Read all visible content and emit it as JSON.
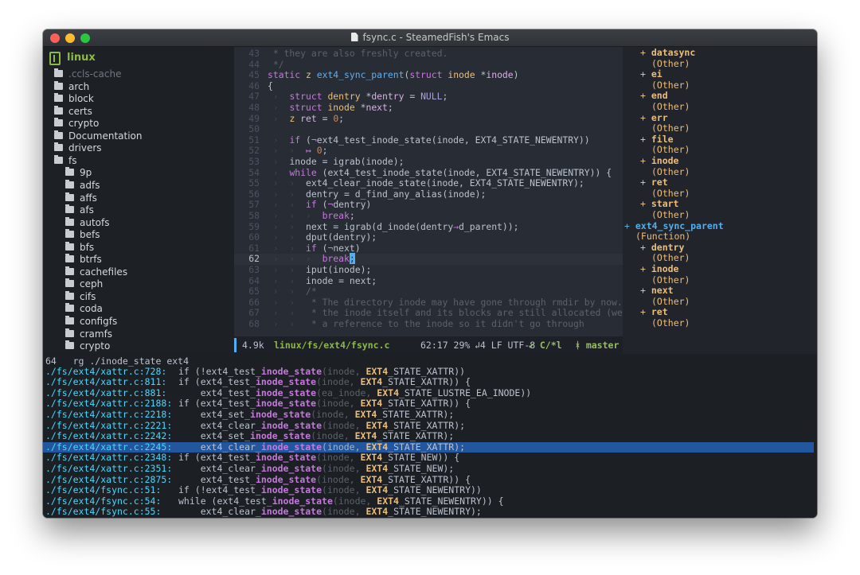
{
  "window": {
    "title": "fsync.c - SteamedFish's Emacs"
  },
  "sidebar": {
    "project": "linux",
    "items": [
      {
        "label": ".ccls-cache",
        "depth": 0,
        "dim": true
      },
      {
        "label": "arch",
        "depth": 0
      },
      {
        "label": "block",
        "depth": 0
      },
      {
        "label": "certs",
        "depth": 0
      },
      {
        "label": "crypto",
        "depth": 0
      },
      {
        "label": "Documentation",
        "depth": 0
      },
      {
        "label": "drivers",
        "depth": 0
      },
      {
        "label": "fs",
        "depth": 0
      },
      {
        "label": "9p",
        "depth": 1
      },
      {
        "label": "adfs",
        "depth": 1
      },
      {
        "label": "affs",
        "depth": 1
      },
      {
        "label": "afs",
        "depth": 1
      },
      {
        "label": "autofs",
        "depth": 1
      },
      {
        "label": "befs",
        "depth": 1
      },
      {
        "label": "bfs",
        "depth": 1
      },
      {
        "label": "btrfs",
        "depth": 1
      },
      {
        "label": "cachefiles",
        "depth": 1
      },
      {
        "label": "ceph",
        "depth": 1
      },
      {
        "label": "cifs",
        "depth": 1
      },
      {
        "label": "coda",
        "depth": 1
      },
      {
        "label": "configfs",
        "depth": 1
      },
      {
        "label": "cramfs",
        "depth": 1
      },
      {
        "label": "crypto",
        "depth": 1
      }
    ]
  },
  "editor": {
    "current_line": "62",
    "lines": [
      {
        "n": "43",
        "parts": [
          [
            "cmt",
            " * they are also freshly created."
          ]
        ]
      },
      {
        "n": "44",
        "parts": [
          [
            "cmt",
            " */"
          ]
        ]
      },
      {
        "n": "45",
        "parts": [
          [
            "kw",
            "static "
          ],
          [
            "ty",
            "z "
          ],
          [
            "fn",
            "ext4_sync_parent"
          ],
          [
            "",
            "("
          ],
          [
            "kw",
            "struct "
          ],
          [
            "ty",
            "inode "
          ],
          [
            "",
            "*"
          ],
          [
            "var",
            "inode"
          ],
          [
            "",
            ")"
          ]
        ]
      },
      {
        "n": "46",
        "parts": [
          [
            "",
            "{"
          ]
        ]
      },
      {
        "n": "47",
        "parts": [
          [
            "ind",
            " ›  "
          ],
          [
            "kw",
            "struct "
          ],
          [
            "ty",
            "dentry "
          ],
          [
            "",
            "*"
          ],
          [
            "var",
            "dentry"
          ],
          [
            "",
            " = "
          ],
          [
            "cst",
            "NULL"
          ],
          [
            "",
            ";"
          ]
        ]
      },
      {
        "n": "48",
        "parts": [
          [
            "ind",
            " ›  "
          ],
          [
            "kw",
            "struct "
          ],
          [
            "ty",
            "inode "
          ],
          [
            "",
            "*"
          ],
          [
            "var",
            "next"
          ],
          [
            "",
            ";"
          ]
        ]
      },
      {
        "n": "49",
        "parts": [
          [
            "ind",
            " ›  "
          ],
          [
            "ty",
            "z "
          ],
          [
            "var",
            "ret"
          ],
          [
            "",
            " = "
          ],
          [
            "num",
            "0"
          ],
          [
            "",
            ";"
          ]
        ]
      },
      {
        "n": "50",
        "parts": [
          [
            "",
            ""
          ]
        ]
      },
      {
        "n": "51",
        "parts": [
          [
            "ind",
            " ›  "
          ],
          [
            "kw",
            "if "
          ],
          [
            "",
            "("
          ],
          [
            "op",
            "¬"
          ],
          [
            "",
            "ext4_test_inode_state(inode, EXT4_STATE_NEWENTRY))"
          ]
        ]
      },
      {
        "n": "52",
        "parts": [
          [
            "ind",
            " ›  ›  "
          ],
          [
            "op",
            "↦ "
          ],
          [
            "num",
            "0"
          ],
          [
            "",
            ";"
          ]
        ]
      },
      {
        "n": "53",
        "parts": [
          [
            "ind",
            " ›  "
          ],
          [
            "",
            "inode = igrab(inode);"
          ]
        ]
      },
      {
        "n": "54",
        "parts": [
          [
            "ind",
            " ›  "
          ],
          [
            "kw",
            "while "
          ],
          [
            "",
            "(ext4_test_inode_state(inode, EXT4_STATE_NEWENTRY)) {"
          ]
        ]
      },
      {
        "n": "55",
        "parts": [
          [
            "ind",
            " ›  ›  "
          ],
          [
            "",
            "ext4_clear_inode_state(inode, EXT4_STATE_NEWENTRY);"
          ]
        ]
      },
      {
        "n": "56",
        "parts": [
          [
            "ind",
            " ›  ›  "
          ],
          [
            "",
            "dentry = d_find_any_alias(inode);"
          ]
        ]
      },
      {
        "n": "57",
        "parts": [
          [
            "ind",
            " ›  ›  "
          ],
          [
            "kw",
            "if "
          ],
          [
            "",
            "("
          ],
          [
            "op",
            "¬"
          ],
          [
            "",
            "dentry)"
          ]
        ]
      },
      {
        "n": "58",
        "parts": [
          [
            "ind",
            " ›  ›  ›  "
          ],
          [
            "kw",
            "break"
          ],
          [
            "",
            ";"
          ]
        ]
      },
      {
        "n": "59",
        "parts": [
          [
            "ind",
            " ›  ›  "
          ],
          [
            "",
            "next = igrab(d_inode(dentry"
          ],
          [
            "op",
            "→"
          ],
          [
            "",
            "d_parent));"
          ]
        ]
      },
      {
        "n": "60",
        "parts": [
          [
            "ind",
            " ›  ›  "
          ],
          [
            "",
            "dput(dentry);"
          ]
        ]
      },
      {
        "n": "61",
        "parts": [
          [
            "ind",
            " ›  ›  "
          ],
          [
            "kw",
            "if "
          ],
          [
            "",
            "("
          ],
          [
            "op",
            "¬"
          ],
          [
            "",
            "next)"
          ]
        ]
      },
      {
        "n": "62",
        "parts": [
          [
            "ind",
            " ›  ›  ›  "
          ],
          [
            "kw",
            "break"
          ],
          [
            "cursor",
            ";"
          ]
        ]
      },
      {
        "n": "63",
        "parts": [
          [
            "ind",
            " ›  ›  "
          ],
          [
            "",
            "iput(inode);"
          ]
        ]
      },
      {
        "n": "64",
        "parts": [
          [
            "ind",
            " ›  ›  "
          ],
          [
            "",
            "inode = next;"
          ]
        ]
      },
      {
        "n": "65",
        "parts": [
          [
            "ind",
            " ›  ›  "
          ],
          [
            "cmt",
            "/*"
          ]
        ]
      },
      {
        "n": "66",
        "parts": [
          [
            "ind",
            " ›  ›  "
          ],
          [
            "cmt",
            " * The directory inode may have gone through rmdir by now."
          ]
        ]
      },
      {
        "n": "67",
        "parts": [
          [
            "ind",
            " ›  ›  "
          ],
          [
            "cmt",
            " * the inode itself and its blocks are still allocated (we"
          ]
        ]
      },
      {
        "n": "68",
        "parts": [
          [
            "ind",
            " ›  ›  "
          ],
          [
            "cmt",
            " * a reference to the inode so it didn't go through"
          ]
        ]
      }
    ]
  },
  "modeline": {
    "size": "4.9k",
    "path": "linux/fs/ext4/fsync.c",
    "position": "62:17 29%",
    "encoding": "↲4 LF UTF-8",
    "mode": "✔ C/*l",
    "branch": "ᚼ master"
  },
  "outline": {
    "items": [
      {
        "kind": "var",
        "indent": 1,
        "name": "datasync",
        "type": "(Other)"
      },
      {
        "kind": "var",
        "indent": 1,
        "name": "ei",
        "type": "(Other)"
      },
      {
        "kind": "var",
        "indent": 1,
        "name": "end",
        "type": "(Other)"
      },
      {
        "kind": "var",
        "indent": 1,
        "name": "err",
        "type": "(Other)"
      },
      {
        "kind": "var",
        "indent": 1,
        "name": "file",
        "type": "(Other)"
      },
      {
        "kind": "var",
        "indent": 1,
        "name": "inode",
        "type": "(Other)"
      },
      {
        "kind": "var",
        "indent": 1,
        "name": "ret",
        "type": "(Other)"
      },
      {
        "kind": "var",
        "indent": 1,
        "name": "start",
        "type": "(Other)"
      },
      {
        "kind": "func",
        "indent": 0,
        "name": "ext4_sync_parent",
        "type": "(Function)"
      },
      {
        "kind": "var",
        "indent": 1,
        "name": "dentry",
        "type": "(Other)"
      },
      {
        "kind": "var",
        "indent": 1,
        "name": "inode",
        "type": "(Other)"
      },
      {
        "kind": "var",
        "indent": 1,
        "name": "next",
        "type": "(Other)"
      },
      {
        "kind": "var",
        "indent": 1,
        "name": "ret",
        "type": "(Other)"
      }
    ]
  },
  "rg": {
    "header": "64   rg ./inode_state ext4",
    "selected_index": 7,
    "rows": [
      {
        "file": "./fs/ext4/xattr.c:728:",
        "pre": "if (!ext4_test_",
        "arg": "inode, ",
        "hi": "EXT4",
        "post": "_STATE_XATTR))"
      },
      {
        "file": "./fs/ext4/xattr.c:811:",
        "pre": "if (ext4_test_",
        "arg": "inode, ",
        "hi": "EXT4",
        "post": "_STATE_XATTR)) {"
      },
      {
        "file": "./fs/ext4/xattr.c:881:",
        "pre": "    ext4_test_",
        "arg": "ea_inode, ",
        "hi": "EXT4",
        "post": "_STATE_LUSTRE_EA_INODE))"
      },
      {
        "file": "./fs/ext4/xattr.c:2188:",
        "pre": "if (ext4_test_",
        "arg": "inode, ",
        "hi": "EXT4",
        "post": "_STATE_XATTR)) {"
      },
      {
        "file": "./fs/ext4/xattr.c:2218:",
        "pre": "    ext4_set_",
        "arg": "inode, ",
        "hi": "EXT4",
        "post": "_STATE_XATTR);"
      },
      {
        "file": "./fs/ext4/xattr.c:2221:",
        "pre": "    ext4_clear_",
        "arg": "inode, ",
        "hi": "EXT4",
        "post": "_STATE_XATTR);"
      },
      {
        "file": "./fs/ext4/xattr.c:2242:",
        "pre": "    ext4_set_",
        "arg": "inode, ",
        "hi": "EXT4",
        "post": "_STATE_XATTR);"
      },
      {
        "file": "./fs/ext4/xattr.c:2245:",
        "pre": "    ext4_clear_",
        "arg": "inode, ",
        "hi": "EXT4",
        "post": "_STATE_XATTR);"
      },
      {
        "file": "./fs/ext4/xattr.c:2348:",
        "pre": "if (ext4_test_",
        "arg": "inode, ",
        "hi": "EXT4",
        "post": "_STATE_NEW)) {"
      },
      {
        "file": "./fs/ext4/xattr.c:2351:",
        "pre": "    ext4_clear_",
        "arg": "inode, ",
        "hi": "EXT4",
        "post": "_STATE_NEW);"
      },
      {
        "file": "./fs/ext4/xattr.c:2875:",
        "pre": "    ext4_test_",
        "arg": "inode, ",
        "hi": "EXT4",
        "post": "_STATE_XATTR)) {"
      },
      {
        "file": "./fs/ext4/fsync.c:51:",
        "pre": "if (!ext4_test_",
        "arg": "inode, ",
        "hi": "EXT4",
        "post": "_STATE_NEWENTRY))"
      },
      {
        "file": "./fs/ext4/fsync.c:54:",
        "pre": "while (ext4_test_",
        "arg": "inode, ",
        "hi": "EXT4",
        "post": "_STATE_NEWENTRY)) {"
      },
      {
        "file": "./fs/ext4/fsync.c:55:",
        "pre": "    ext4_clear_",
        "arg": "inode, ",
        "hi": "EXT4",
        "post": "_STATE_NEWENTRY);"
      }
    ],
    "match": "inode_state",
    "paren": "("
  }
}
